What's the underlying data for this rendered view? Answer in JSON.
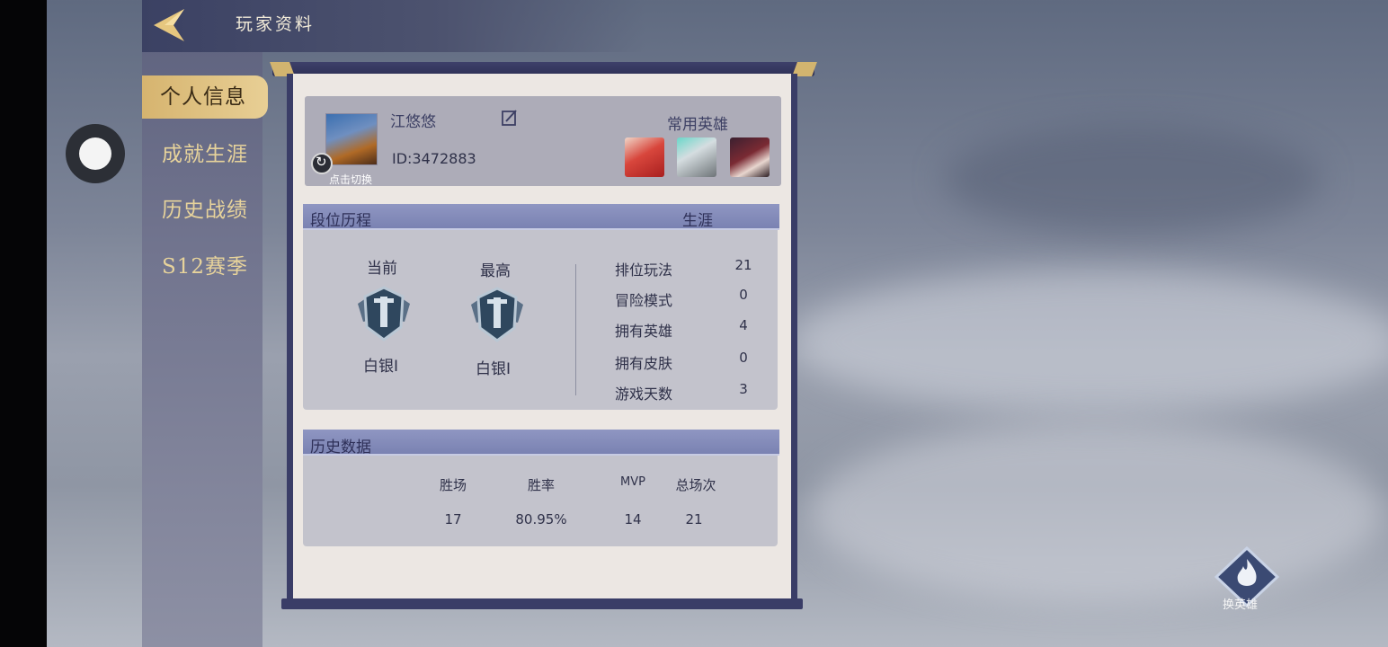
{
  "header": {
    "title": "玩家资料"
  },
  "sidebar": {
    "items": [
      {
        "label": "个人信息",
        "active": true
      },
      {
        "label": "成就生涯",
        "active": false
      },
      {
        "label": "历史战绩",
        "active": false
      },
      {
        "label": "S12赛季",
        "active": false
      }
    ]
  },
  "profile": {
    "name": "江悠悠",
    "id": "ID:3472883",
    "switch_hint": "点击切换",
    "common_heroes_label": "常用英雄",
    "edit_icon": "edit-icon"
  },
  "rank": {
    "section_title": "段位历程",
    "career_label": "生涯",
    "current_label": "当前",
    "current_rank": "白银I",
    "highest_label": "最高",
    "highest_rank": "白银I",
    "stats": [
      {
        "label": "排位玩法",
        "value": "21"
      },
      {
        "label": "冒险模式",
        "value": "0"
      },
      {
        "label": "拥有英雄",
        "value": "4"
      },
      {
        "label": "拥有皮肤",
        "value": "0"
      },
      {
        "label": "游戏天数",
        "value": "3"
      }
    ]
  },
  "history": {
    "section_title": "历史数据",
    "headers": [
      "胜场",
      "胜率",
      "MVP",
      "总场次"
    ],
    "values": [
      "17",
      "80.95%",
      "14",
      "21"
    ]
  },
  "switch_hero": {
    "label": "换英雄"
  },
  "colors": {
    "accent_gold": "#d6b46f",
    "panel_frame": "#3a3d67",
    "section_header": "#8f96c2"
  }
}
